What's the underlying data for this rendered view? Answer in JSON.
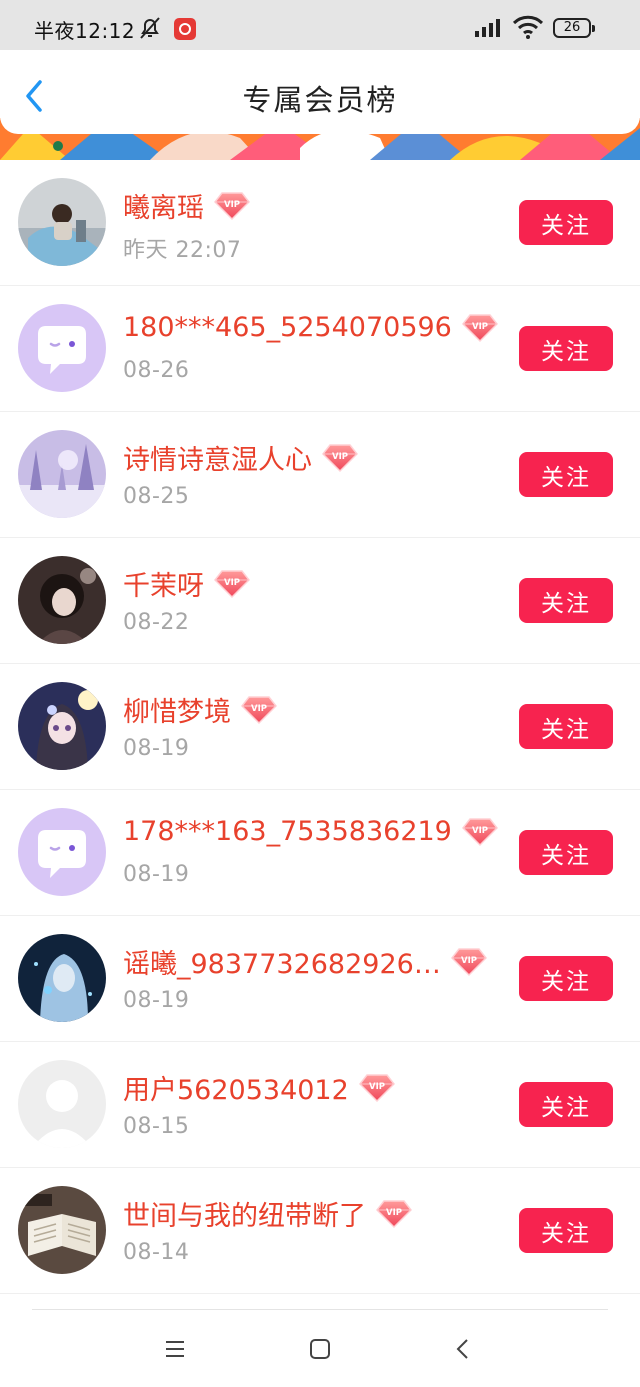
{
  "status_bar": {
    "time": "半夜12:12",
    "battery": "26"
  },
  "header": {
    "title": "专属会员榜"
  },
  "members": [
    {
      "name": "曦离瑶",
      "date": "昨天 22:07",
      "avatar": "photo-child",
      "follow": "关注"
    },
    {
      "name": "180***465_5254070596",
      "date": "08-26",
      "avatar": "default-chat",
      "follow": "关注"
    },
    {
      "name": "诗情诗意湿人心",
      "date": "08-25",
      "avatar": "winter-forest",
      "follow": "关注"
    },
    {
      "name": "千茉呀",
      "date": "08-22",
      "avatar": "dark-anime",
      "follow": "关注"
    },
    {
      "name": "柳惜梦境",
      "date": "08-19",
      "avatar": "anime-girl",
      "follow": "关注"
    },
    {
      "name": "178***163_7535836219",
      "date": "08-19",
      "avatar": "default-chat",
      "follow": "关注"
    },
    {
      "name": "谣曦_9837732682926…",
      "date": "08-19",
      "avatar": "blue-anime",
      "follow": "关注"
    },
    {
      "name": "用户5620534012",
      "date": "08-15",
      "avatar": "default-person",
      "follow": "关注"
    },
    {
      "name": "世间与我的纽带断了",
      "date": "08-14",
      "avatar": "open-book",
      "follow": "关注"
    }
  ],
  "vip_label": "VIP",
  "colors": {
    "accent_red": "#f7234f",
    "name_red": "#e8412c",
    "date_gray": "#a6a6a6",
    "back_blue": "#2196f3"
  }
}
